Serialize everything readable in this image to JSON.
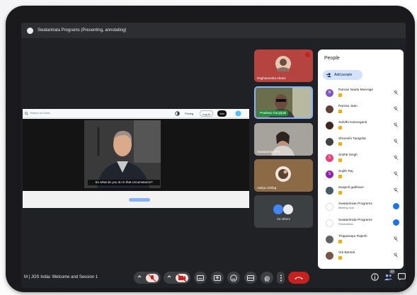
{
  "window": {
    "title": "Swatantrata Programs (Presenting, annotating)"
  },
  "presentation": {
    "search_placeholder": "Search on Kiwix",
    "toolbar_buttons": [
      "Pricing",
      "Log in",
      "Join"
    ],
    "caption": "So what do you do in that circumstance?"
  },
  "tiles": [
    {
      "name": "Raghavendra Aleani",
      "muted": true
    },
    {
      "name": "Pradeep Ganyipati",
      "speaking": true,
      "muted": false
    },
    {
      "name": "Swatantrata Pro",
      "muted": false
    },
    {
      "name": "Aaliya Ashfaq",
      "muted": false
    }
  ],
  "others_tile": {
    "label": "23 others"
  },
  "people_panel": {
    "title": "People",
    "add_people_label": "Add people",
    "participants": [
      {
        "name": "Raman Naidu Meenige",
        "avatar_letter": "R",
        "avatar_color": "#7e57c2",
        "muted": true
      },
      {
        "name": "Ramsa Jaan",
        "avatar_letter": "",
        "avatar_color": "#5d4037",
        "muted": true
      },
      {
        "name": "Sahithi Kanneganti",
        "avatar_letter": "",
        "avatar_color": "#3e2723",
        "muted": true
      },
      {
        "name": "Shreeshi Tarapdar",
        "avatar_letter": "",
        "avatar_color": "#424242",
        "muted": true
      },
      {
        "name": "Srishti Singh",
        "avatar_letter": "S",
        "avatar_color": "#ec407a",
        "muted": true
      },
      {
        "name": "Sujith Raj",
        "avatar_letter": "S",
        "avatar_color": "#8e24aa",
        "muted": true
      },
      {
        "name": "swapnil gadhave",
        "avatar_letter": "",
        "avatar_color": "#455a64",
        "muted": true
      },
      {
        "name": "Swatantrata Programs",
        "sub": "Meeting host",
        "avatar_letter": "",
        "avatar_color": "#ffffff",
        "host": true
      },
      {
        "name": "Swatantrata Programs",
        "sub": "Presentation",
        "avatar_letter": "",
        "avatar_color": "#ffffff",
        "host": true
      },
      {
        "name": "Thipparapu Rajesh",
        "avatar_letter": "",
        "avatar_color": "#616161",
        "muted": true
      },
      {
        "name": "Vrti Bansal",
        "avatar_letter": "",
        "avatar_color": "#795548",
        "muted": true
      }
    ]
  },
  "bottom_bar": {
    "meeting_name": "M | JOS India: Welcome and Session 1",
    "participant_count": "27"
  },
  "colors": {
    "screen_bg": "#202124",
    "accent_red": "#c5221f",
    "accent_blue": "#1a73e8",
    "add_people_bg": "#d3e3fd"
  }
}
